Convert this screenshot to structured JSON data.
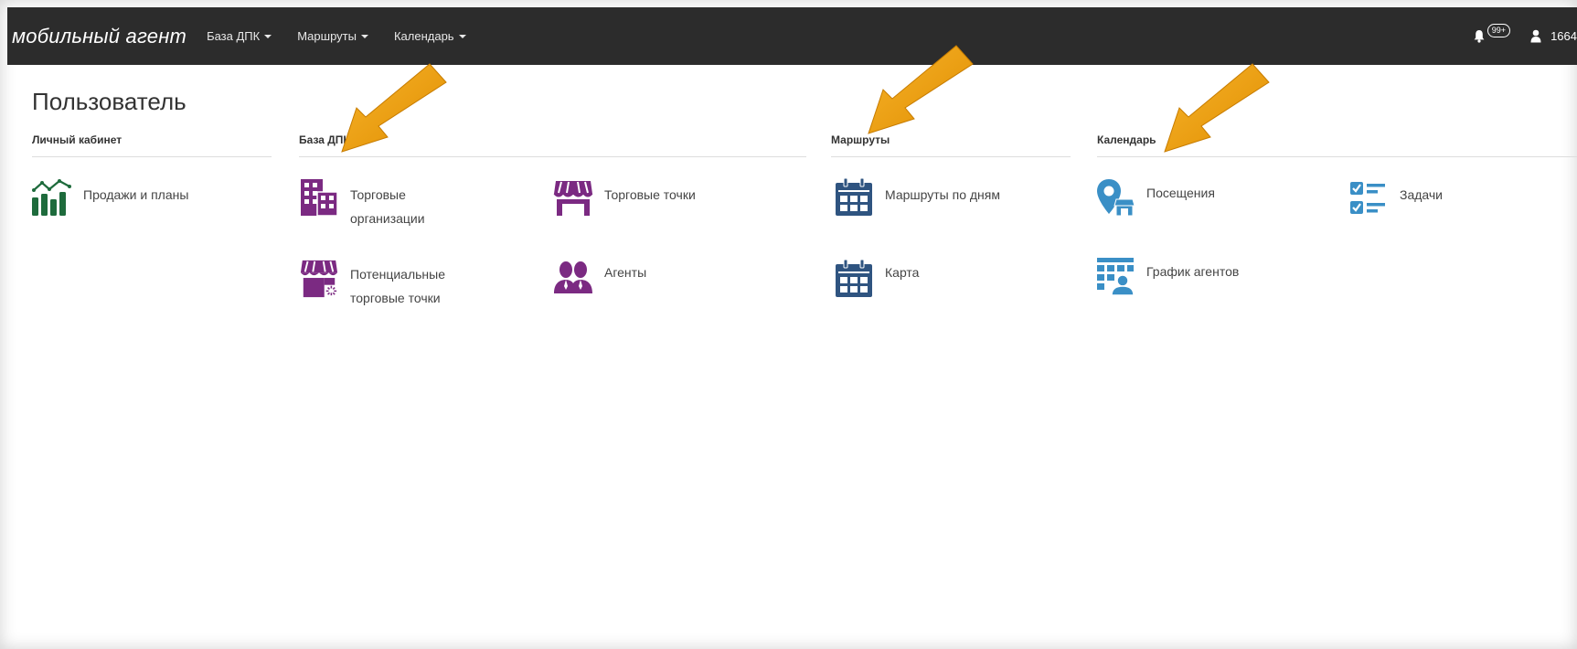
{
  "navbar": {
    "brand": "мобильный агент",
    "items": [
      {
        "label": "База ДПК"
      },
      {
        "label": "Маршруты"
      },
      {
        "label": "Календарь"
      }
    ],
    "notifications_badge": "99+",
    "user_label": "1664"
  },
  "page": {
    "title": "Пользователь"
  },
  "sections": {
    "cabinet": {
      "title": "Личный кабинет",
      "tiles": [
        {
          "label": "Продажи и планы",
          "icon": "sales-chart-icon"
        }
      ]
    },
    "dpk": {
      "title": "База ДПК",
      "tiles": [
        {
          "label": "Торговые организации",
          "icon": "building-icon"
        },
        {
          "label": "Торговые точки",
          "icon": "store-icon"
        },
        {
          "label": "Потенциальные торговые точки",
          "icon": "potential-store-icon"
        },
        {
          "label": "Агенты",
          "icon": "agents-icon"
        }
      ]
    },
    "routes": {
      "title": "Маршруты",
      "tiles": [
        {
          "label": "Маршруты по дням",
          "icon": "calendar-icon"
        },
        {
          "label": "Карта",
          "icon": "calendar-map-icon"
        }
      ]
    },
    "calendar": {
      "title": "Календарь",
      "tiles": [
        {
          "label": "Посещения",
          "icon": "visit-pin-icon"
        },
        {
          "label": "Задачи",
          "icon": "tasks-checklist-icon"
        },
        {
          "label": "График агентов",
          "icon": "agent-schedule-icon"
        }
      ]
    }
  },
  "colors": {
    "navbar": "#2c2c2c",
    "green": "#1e6b3c",
    "purple": "#7b2a82",
    "navy": "#2f5480",
    "blue": "#3a8fc6",
    "arrow": "#f0a000"
  }
}
